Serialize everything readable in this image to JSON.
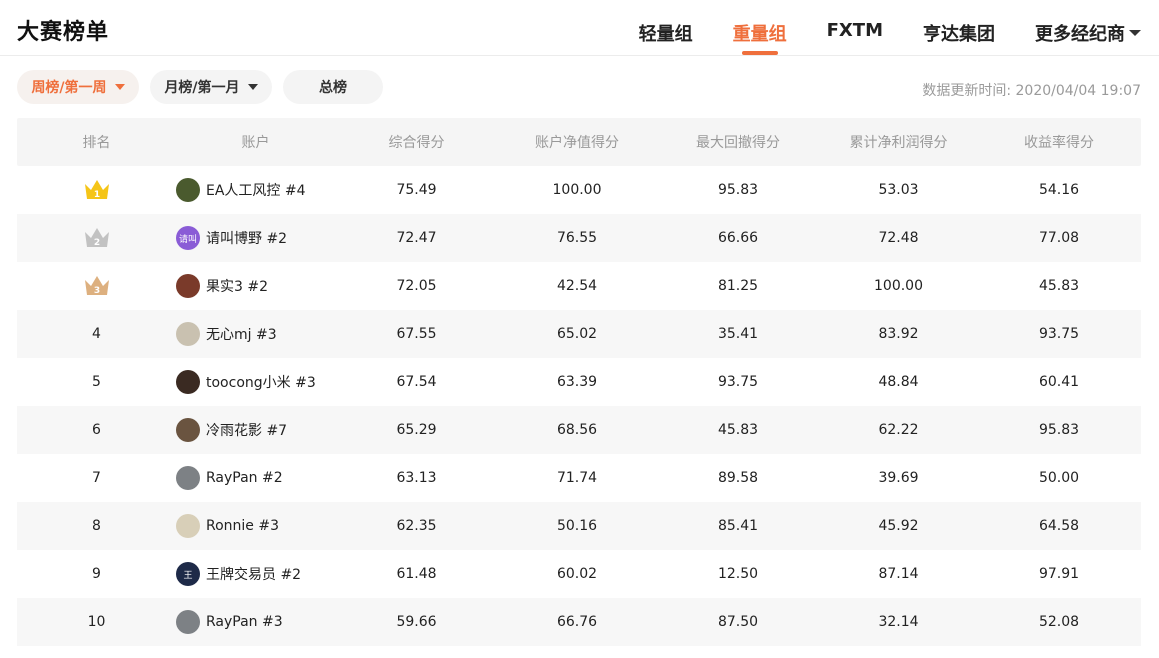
{
  "header": {
    "title": "大赛榜单",
    "tabs": [
      {
        "label": "轻量组",
        "active": false
      },
      {
        "label": "重量组",
        "active": true
      },
      {
        "label": "FXTM",
        "active": false
      },
      {
        "label": "亨达集团",
        "active": false
      },
      {
        "label": "更多经纪商",
        "active": false,
        "has_dropdown": true
      }
    ]
  },
  "filters": {
    "weekly": "周榜/第一周",
    "monthly": "月榜/第一月",
    "total": "总榜"
  },
  "update_time": "数据更新时间: 2020/04/04 19:07",
  "colors": {
    "accent": "#ef6f3c",
    "gold": "#f5c518",
    "silver": "#c2c2c2",
    "bronze": "#ddb07f"
  },
  "table": {
    "columns": [
      "排名",
      "账户",
      "综合得分",
      "账户净值得分",
      "最大回撤得分",
      "累计净利润得分",
      "收益率得分"
    ],
    "rows": [
      {
        "rank": "1",
        "medal": "gold",
        "avatar_color": "#4a5a2e",
        "avatar_text": "",
        "account": "EA人工风控 #4",
        "s1": "75.49",
        "s2": "100.00",
        "s3": "95.83",
        "s4": "53.03",
        "s5": "54.16"
      },
      {
        "rank": "2",
        "medal": "silver",
        "avatar_color": "#8a5cd6",
        "avatar_text": "请叫",
        "account": "请叫博野 #2",
        "s1": "72.47",
        "s2": "76.55",
        "s3": "66.66",
        "s4": "72.48",
        "s5": "77.08"
      },
      {
        "rank": "3",
        "medal": "bronze",
        "avatar_color": "#7a3a2a",
        "avatar_text": "",
        "account": "果实3 #2",
        "s1": "72.05",
        "s2": "42.54",
        "s3": "81.25",
        "s4": "100.00",
        "s5": "45.83"
      },
      {
        "rank": "4",
        "medal": "",
        "avatar_color": "#c9c1b0",
        "avatar_text": "",
        "account": "无心mj #3",
        "s1": "67.55",
        "s2": "65.02",
        "s3": "35.41",
        "s4": "83.92",
        "s5": "93.75"
      },
      {
        "rank": "5",
        "medal": "",
        "avatar_color": "#3a2a22",
        "avatar_text": "",
        "account": "toocong小米 #3",
        "s1": "67.54",
        "s2": "63.39",
        "s3": "93.75",
        "s4": "48.84",
        "s5": "60.41"
      },
      {
        "rank": "6",
        "medal": "",
        "avatar_color": "#6a5440",
        "avatar_text": "",
        "account": "冷雨花影 #7",
        "s1": "65.29",
        "s2": "68.56",
        "s3": "45.83",
        "s4": "62.22",
        "s5": "95.83"
      },
      {
        "rank": "7",
        "medal": "",
        "avatar_color": "#7d8185",
        "avatar_text": "",
        "account": "RayPan #2",
        "s1": "63.13",
        "s2": "71.74",
        "s3": "89.58",
        "s4": "39.69",
        "s5": "50.00"
      },
      {
        "rank": "8",
        "medal": "",
        "avatar_color": "#d8cfb8",
        "avatar_text": "",
        "account": "Ronnie #3",
        "s1": "62.35",
        "s2": "50.16",
        "s3": "85.41",
        "s4": "45.92",
        "s5": "64.58"
      },
      {
        "rank": "9",
        "medal": "",
        "avatar_color": "#1e2a48",
        "avatar_text": "王",
        "account": "王牌交易员 #2",
        "s1": "61.48",
        "s2": "60.02",
        "s3": "12.50",
        "s4": "87.14",
        "s5": "97.91"
      },
      {
        "rank": "10",
        "medal": "",
        "avatar_color": "#7d8185",
        "avatar_text": "",
        "account": "RayPan #3",
        "s1": "59.66",
        "s2": "66.76",
        "s3": "87.50",
        "s4": "32.14",
        "s5": "52.08"
      }
    ]
  }
}
